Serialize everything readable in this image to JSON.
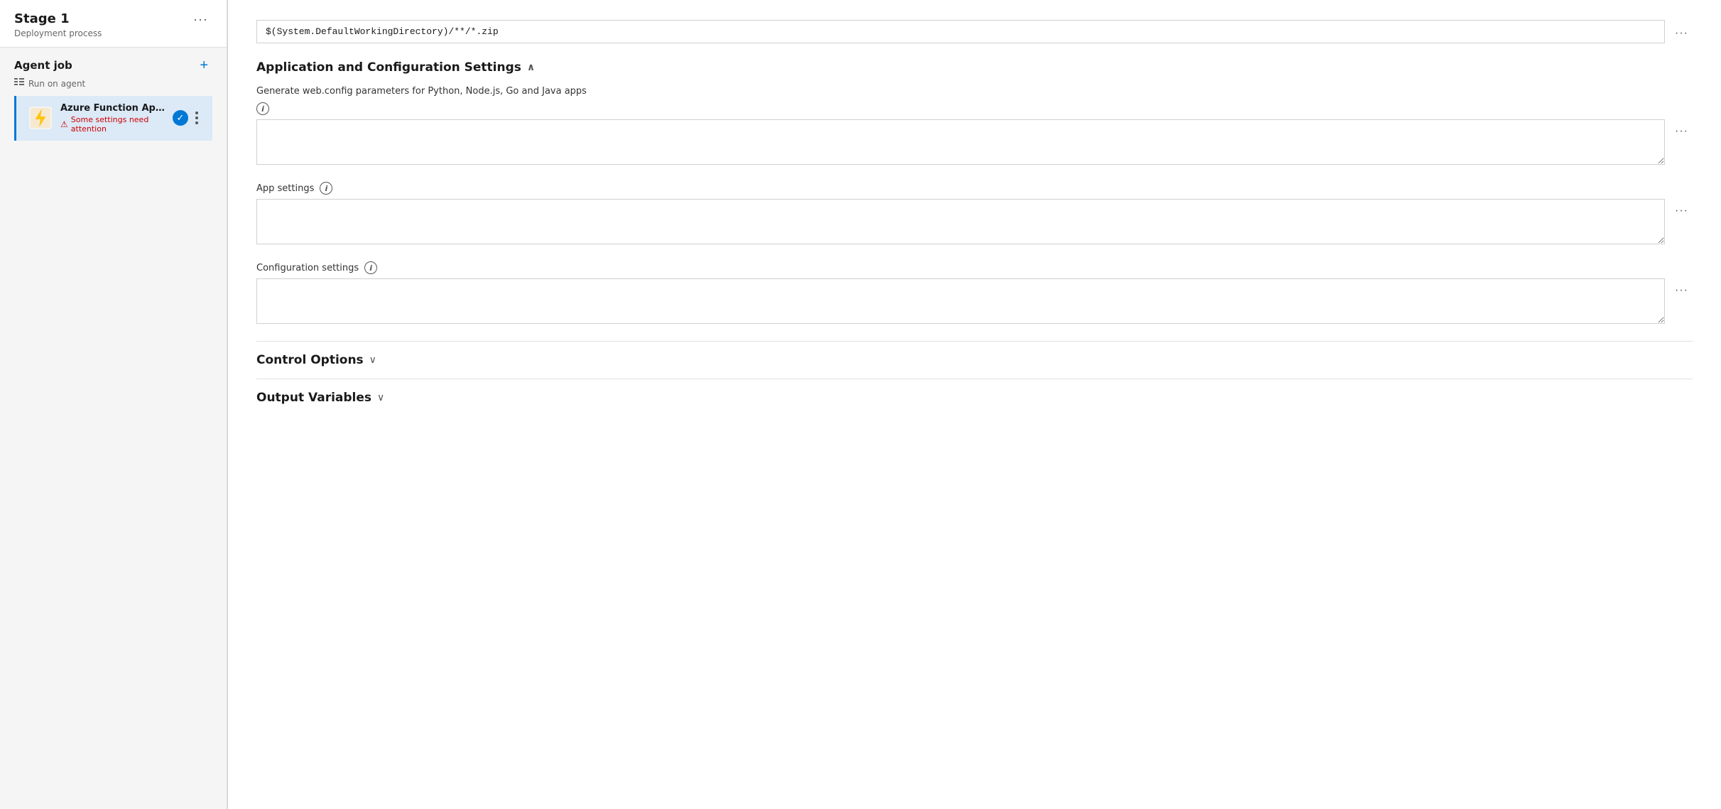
{
  "left": {
    "stage": {
      "title": "Stage 1",
      "subtitle": "Deployment process",
      "more_label": "···"
    },
    "agent_job": {
      "title": "Agent job",
      "subtitle": "Run on agent",
      "add_label": "+"
    },
    "task": {
      "name": "Azure Function App Deploy:",
      "warning": "Some settings need attention",
      "more_label": "···"
    }
  },
  "right": {
    "path_input": {
      "value": "$(System.DefaultWorkingDirectory)/**/*.zip",
      "more_label": "···"
    },
    "app_config_section": {
      "title": "Application and Configuration Settings",
      "chevron": "∧"
    },
    "web_config": {
      "description": "Generate web.config parameters for Python, Node.js, Go and Java apps",
      "value": "",
      "more_label": "···"
    },
    "app_settings": {
      "label": "App settings",
      "value": "",
      "more_label": "···"
    },
    "config_settings": {
      "label": "Configuration settings",
      "value": "",
      "more_label": "···"
    },
    "control_options": {
      "title": "Control Options",
      "chevron": "∨"
    },
    "output_variables": {
      "title": "Output Variables",
      "chevron": "∨"
    }
  }
}
